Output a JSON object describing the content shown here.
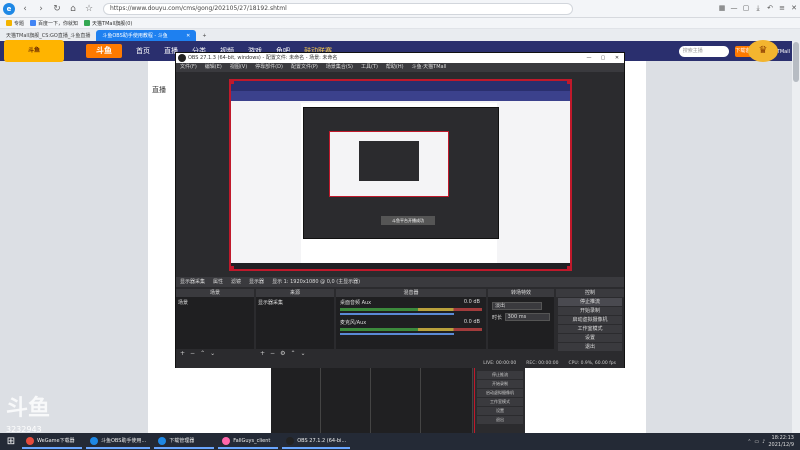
{
  "browser": {
    "url": "https://www.douyu.com/cms/gong/202105/27/18192.shtml",
    "bookmarks": [
      "专题",
      "百度一下，你就知",
      "天猫TMall旗舰(0)"
    ],
    "tabs": [
      {
        "label": "天猫TMall旗舰_CS:GO直播_斗鱼直播"
      },
      {
        "label": "斗鱼OBS助手使用教程 - 斗鱼"
      }
    ]
  },
  "site": {
    "logo": "斗鱼",
    "nav": [
      "首页",
      "直播",
      "分类",
      "视频",
      "游戏",
      "鱼吧",
      "鼓动联赛"
    ],
    "search_placeholder": "搜索主播",
    "badge": "下载客户端",
    "user": "天猫TMall",
    "page_heading": "直播",
    "game_icon": "斗鱼",
    "crown": "♛"
  },
  "obs": {
    "title": "OBS 27.1.3 (64-bit, windows) - 配置文件: 未命名 - 场景: 未命名",
    "menu": [
      "文件(F)",
      "编辑(E)",
      "视图(V)",
      "停靠部件(D)",
      "配置文件(P)",
      "场景集合(S)",
      "工具(T)",
      "帮助(H)",
      "斗鱼·天猫TMall"
    ],
    "toast": "斗鱼平台开播成功",
    "source_bar": [
      "显示器采集",
      "属性",
      "滤镜",
      "显示器",
      "显示 1: 1920x1080 @ 0,0 (主显示器)"
    ],
    "docks": {
      "scenes": {
        "title": "场景",
        "items": [
          "场景"
        ]
      },
      "sources": {
        "title": "来源",
        "items": [
          "显示器采集"
        ]
      },
      "mixer": {
        "title": "混音器",
        "channels": [
          {
            "name": "桌面音频 Aux",
            "db": "0.0 dB"
          },
          {
            "name": "麦克风/Aux",
            "db": "0.0 dB"
          }
        ]
      },
      "transitions": {
        "title": "转场特效",
        "type": "淡出",
        "duration_label": "时长",
        "duration": "300 ms"
      },
      "controls": {
        "title": "控制",
        "buttons": [
          "停止推流",
          "开始录制",
          "启动虚拟摄像机",
          "工作室模式",
          "设置",
          "退出"
        ]
      }
    },
    "status": [
      "LIVE: 00:00:00",
      "REC: 00:00:00",
      "CPU: 0.9%, 60.00 fps"
    ]
  },
  "bg_obs_menu": [
    "停止推流",
    "开始录制",
    "启动虚拟摄像机",
    "工作室模式",
    "设置",
    "退出"
  ],
  "watermark": "斗鱼",
  "watermark_number": "3232943",
  "taskbar": {
    "items": [
      {
        "label": "WeGame下载器",
        "color": "#e74c3c"
      },
      {
        "label": "斗鱼OBS助手使用...",
        "color": "#1e88e5"
      },
      {
        "label": "下载管理器",
        "color": "#1e88e5"
      },
      {
        "label": "FallGuys_client",
        "color": "#ff66aa"
      },
      {
        "label": "OBS 27.1.2 (64-bi...",
        "color": "#222222"
      }
    ],
    "time": "18:22:13",
    "date": "2021/12/9"
  }
}
